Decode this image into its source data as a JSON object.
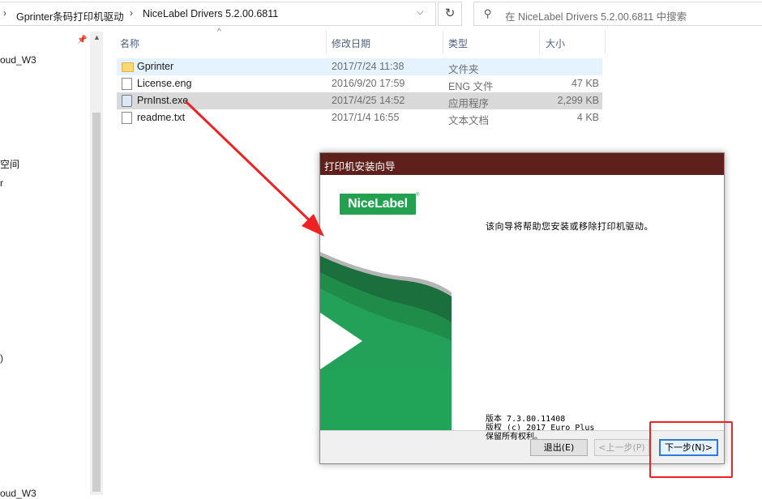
{
  "address_bar": {
    "crumbs": [
      "Gprinter条码打印机驱动",
      "NiceLabel Drivers 5.2.00.6811"
    ],
    "separator": "›",
    "dropdown": "⌵",
    "refresh": "↻"
  },
  "search": {
    "placeholder": "在 NiceLabel Drivers 5.2.00.6811 中搜索"
  },
  "nav": {
    "items": [
      {
        "label": "oud_W3"
      },
      {
        "label": "空间"
      },
      {
        "label": "r"
      },
      {
        "label": ")"
      },
      {
        "label": "oud_W3"
      }
    ]
  },
  "columns": {
    "name": "名称",
    "date": "修改日期",
    "type": "类型",
    "size": "大小"
  },
  "files": [
    {
      "name": "Gprinter",
      "date": "2017/7/24 11:38",
      "type": "文件夹",
      "size": "",
      "icon": "folder-icon"
    },
    {
      "name": "License.eng",
      "date": "2016/9/20 17:59",
      "type": "ENG 文件",
      "size": "47 KB",
      "icon": "document-icon"
    },
    {
      "name": "PrnInst.exe",
      "date": "2017/4/25 14:52",
      "type": "应用程序",
      "size": "2,299 KB",
      "icon": "installer-icon"
    },
    {
      "name": "readme.txt",
      "date": "2017/1/4 16:55",
      "type": "文本文档",
      "size": "4 KB",
      "icon": "text-file-icon"
    }
  ],
  "dialog": {
    "title": "打印机安装向导",
    "logo": "NiceLabel",
    "message": "该向导将帮助您安装或移除打印机驱动。",
    "version_lines": [
      "版本 7.3.80.11408",
      "版权 (c) 2017 Euro Plus",
      "保留所有权利。"
    ],
    "buttons": {
      "exit": "退出(E)",
      "back": "<上一步(P)",
      "next": "下一步(N)>"
    }
  },
  "colors": {
    "dialog_title_bg": "#5f1f1a",
    "brand_green": "#24a150",
    "annotation_red": "#ee2222",
    "selection_gray": "#d9d9d9",
    "folder_hover": "#e5f3ff"
  }
}
